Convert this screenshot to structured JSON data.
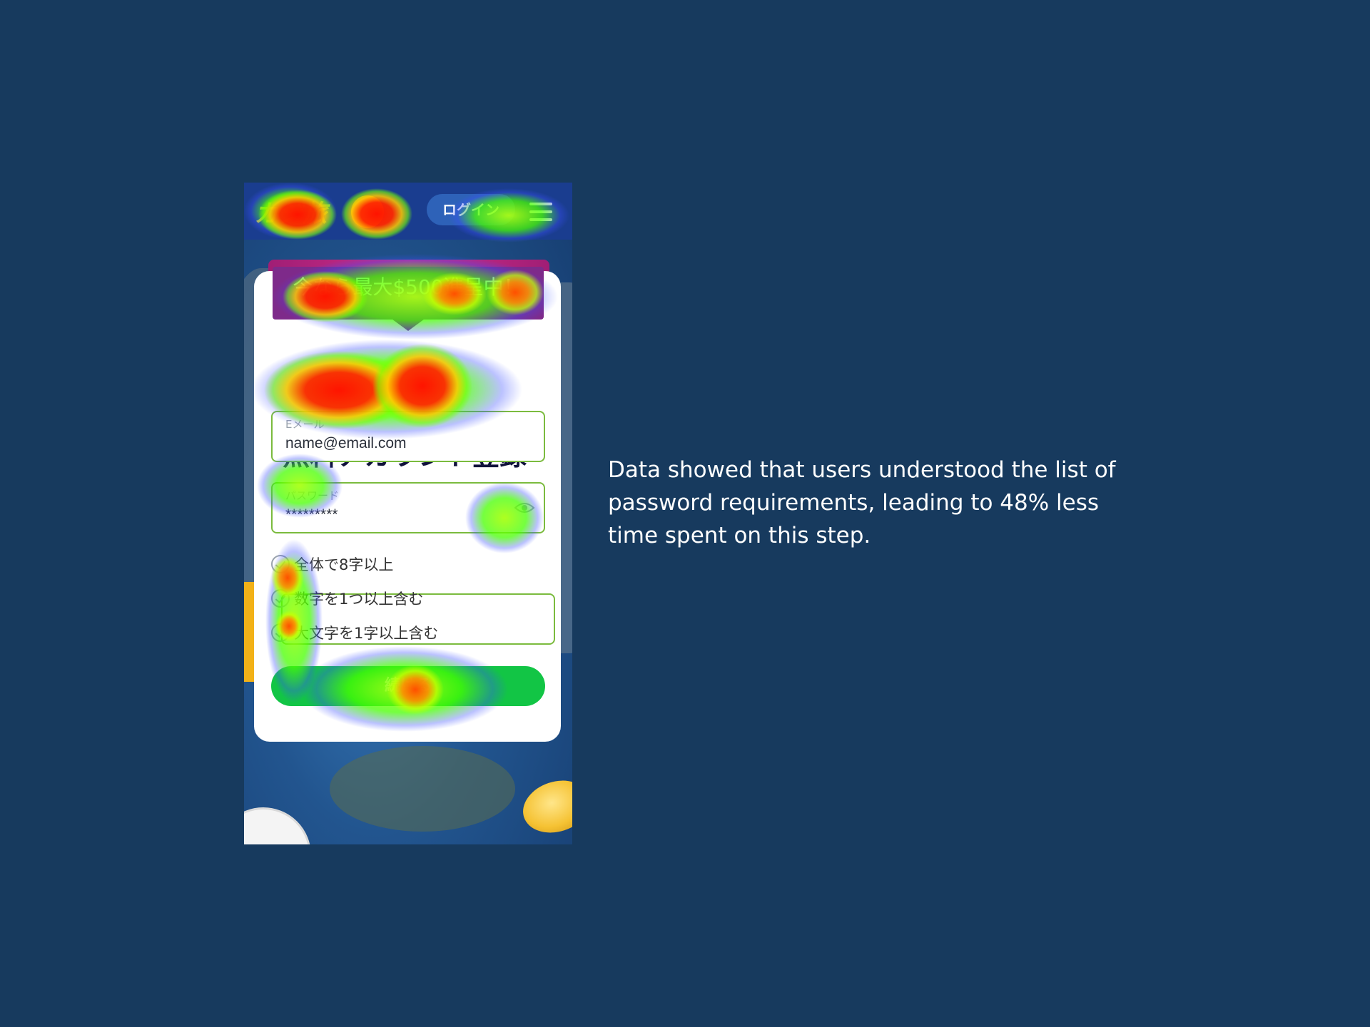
{
  "phone": {
    "logo": "カジ旅",
    "login_label": "ログイン",
    "promo_text": "今なら最大$500進呈中！",
    "form_title": "無料アカウント登録",
    "email": {
      "label": "Eメール",
      "value": "name@email.com"
    },
    "password": {
      "label": "パスワード",
      "value": "*********"
    },
    "requirements": [
      "全体で8字以上",
      "数字を1つ以上含む",
      "大文字を1字以上含む"
    ],
    "continue_label": "続ける",
    "icons": [
      "menu-icon",
      "eye-icon",
      "check-icon"
    ]
  },
  "caption": "Data showed that users understood the list of password requirements, leading to 48% less time spent on this step.",
  "colors": {
    "background": "#173a5e",
    "field_border": "#7bbb3e",
    "continue_button": "#12c545",
    "promo_ribbon": "#7e2a8a"
  }
}
